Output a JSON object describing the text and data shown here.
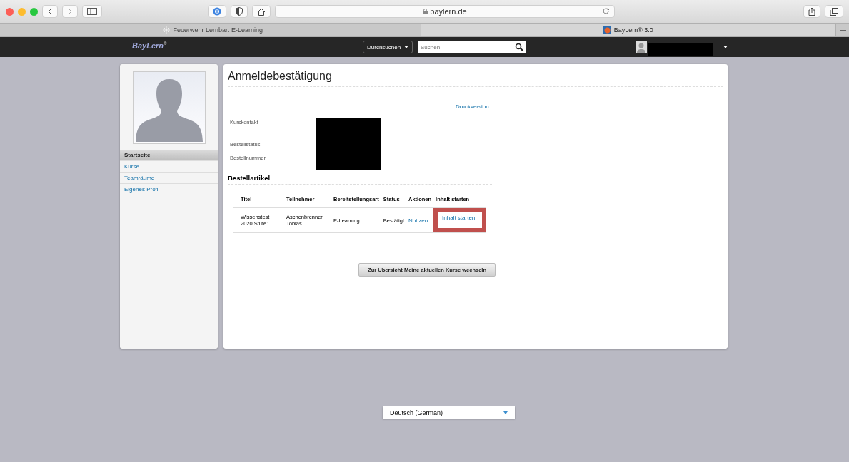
{
  "browser": {
    "url": "baylern.de",
    "tabs": [
      {
        "label": "Feuerwehr Lernbar: E-Learning",
        "selected": false
      },
      {
        "label": "BayLern® 3.0",
        "selected": true
      }
    ]
  },
  "navbar": {
    "logo": "BayLern$^{®}$",
    "search_scope": "Durchsuchen",
    "search": {
      "placeholder": "Suchen"
    }
  },
  "sidebar": {
    "items": [
      {
        "label": "Startseite",
        "selected": true
      },
      {
        "label": "Kurse",
        "selected": false
      },
      {
        "label": "Teamräume",
        "selected": false
      },
      {
        "label": "Eigenes Profil",
        "selected": false
      }
    ]
  },
  "page": {
    "title": "Anmeldebestätigung",
    "print_link": "Druckversion",
    "fields": [
      "Kurskontakt",
      "Bestellstatus",
      "Bestellnummer"
    ],
    "section": "Bestellartikel",
    "table": {
      "columns": [
        "Titel",
        "Teilnehmer",
        "Bereitstellungsart",
        "Status",
        "Aktionen",
        "Inhalt starten"
      ],
      "rows": [
        {
          "title": "Wissenstest 2020 Stufe1",
          "participant": "Aschenbrenner Tobias",
          "delivery": "E-Learning",
          "status": "Bestätigt",
          "action": "Notizen",
          "start": "Inhalt starten",
          "highlighted": true
        }
      ]
    },
    "button": "Zur Übersicht Meine aktuellen Kurse wechseln"
  },
  "language": "Deutsch (German)"
}
